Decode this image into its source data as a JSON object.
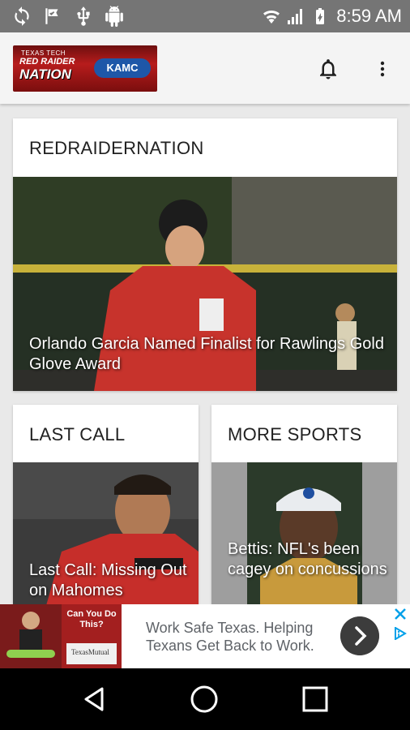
{
  "status_bar": {
    "time": "8:59 AM",
    "left_icons": [
      "sync-icon",
      "check-flag-icon",
      "usb-icon",
      "android-icon"
    ],
    "right_icons": [
      "wifi-icon",
      "signal-icon",
      "battery-icon"
    ]
  },
  "app_bar": {
    "logo": {
      "line1": "TEXAS TECH",
      "line2": "RED RAIDER",
      "line3": "NATION",
      "station": "KAMC"
    },
    "icons": [
      "bell-icon",
      "more-vert-icon"
    ]
  },
  "cards": {
    "main": {
      "title": "REDRAIDERNATION",
      "caption": "Orlando Garcia Named Finalist for Rawlings Gold Glove Award"
    },
    "last_call": {
      "title": "LAST CALL",
      "caption": "Last Call: Missing Out on Mahomes"
    },
    "more_sports": {
      "title": "MORE SPORTS",
      "caption": "Bettis: NFL's been cagey on concussions"
    }
  },
  "ad": {
    "cta": "Can You Do This?",
    "text": "Work Safe Texas. Helping Texans Get Back to Work.",
    "brand": "TexasMutual",
    "icons": [
      "close-icon",
      "ad-choices-icon",
      "chevron-right-icon"
    ]
  },
  "nav_bar": {
    "icons": [
      "back-icon",
      "home-icon",
      "recents-icon"
    ]
  },
  "colors": {
    "status_bar": "#757575",
    "app_bar": "#f4f4f4",
    "background": "#e9e9e9",
    "brand_red": "#b71c1c",
    "ad_accent": "#00a0e9"
  }
}
